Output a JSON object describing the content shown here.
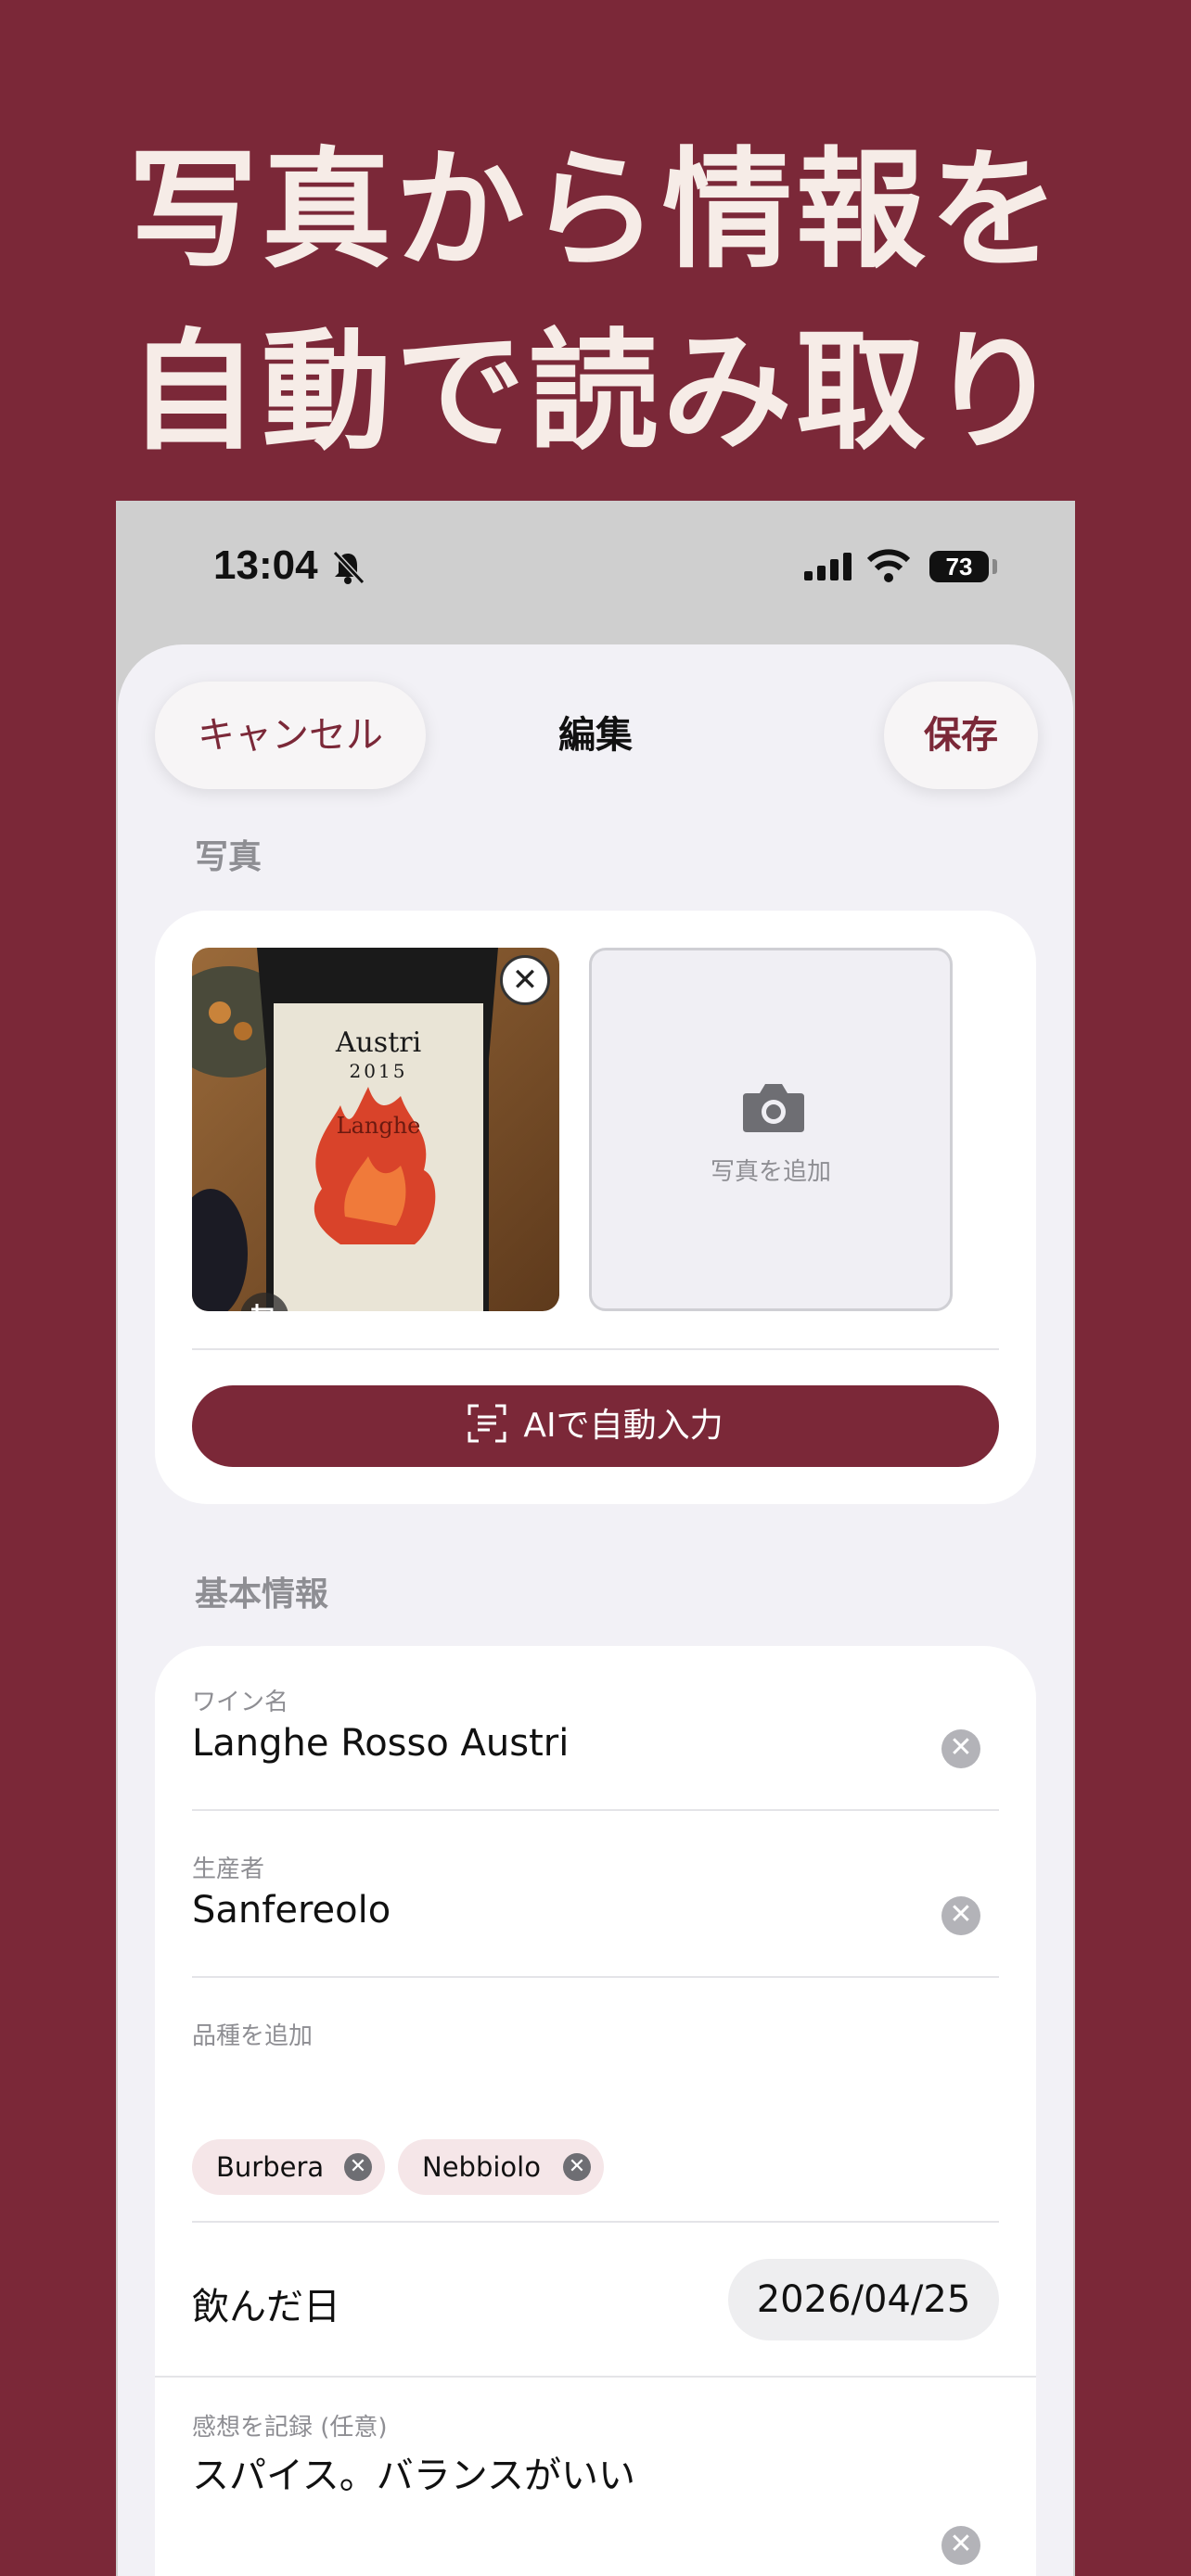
{
  "headline": {
    "line1": "写真から情報を",
    "line2": "自動で読み取り"
  },
  "status_bar": {
    "time": "13:04",
    "battery": "73"
  },
  "nav": {
    "cancel": "キャンセル",
    "title": "編集",
    "save": "保存"
  },
  "photo_section": {
    "label": "写真",
    "add_photo": "写真を追加",
    "label_text": {
      "brand": "Austri",
      "year": "2015",
      "name": "Langhe"
    },
    "ai_button": "AIで自動入力"
  },
  "basic_info": {
    "label": "基本情報",
    "wine_name": {
      "label": "ワイン名",
      "value": "Langhe Rosso Austri"
    },
    "producer": {
      "label": "生産者",
      "value": "Sanfereolo"
    },
    "grape": {
      "label": "品種を追加",
      "chips": [
        "Burbera",
        "Nebbiolo"
      ]
    },
    "drank_date": {
      "label": "飲んだ日",
      "value": "2026/04/25"
    },
    "notes": {
      "label": "感想を記録 (任意)",
      "value": "スパイス。バランスがいい"
    }
  },
  "colors": {
    "brand": "#7b2838",
    "background": "#f2f1f6"
  }
}
